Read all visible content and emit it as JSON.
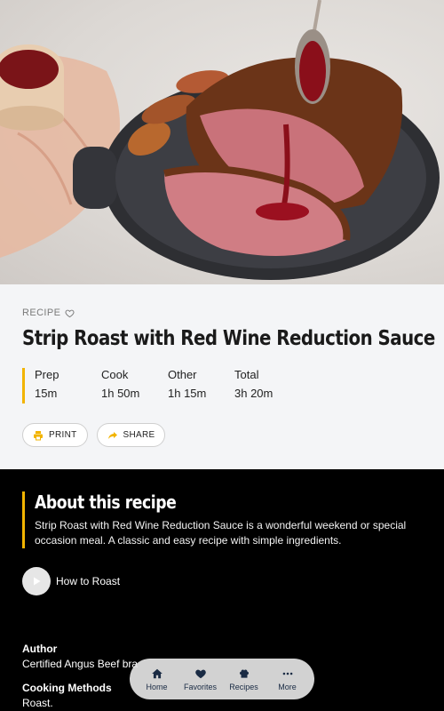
{
  "hero": {
    "alt_subject": "roast"
  },
  "recipe": {
    "eyebrow": "RECIPE",
    "title": "Strip Roast with Red Wine Reduction Sauce",
    "times": [
      {
        "label": "Prep",
        "value": "15m"
      },
      {
        "label": "Cook",
        "value": "1h 50m"
      },
      {
        "label": "Other",
        "value": "1h 15m"
      },
      {
        "label": "Total",
        "value": "3h 20m"
      }
    ],
    "print_label": "PRINT",
    "share_label": "SHARE"
  },
  "about": {
    "heading": "About this recipe",
    "body": "Strip Roast with Red Wine Reduction Sauce is a wonderful weekend or special occasion meal. A classic and easy recipe with simple ingredients.",
    "video_label": "How to Roast",
    "author_label": "Author",
    "author_value": "Certified Angus Beef bra",
    "methods_label": "Cooking Methods",
    "methods_value": "Roast."
  },
  "nav": {
    "items": [
      {
        "label": "Home",
        "icon": "home-icon"
      },
      {
        "label": "Favorites",
        "icon": "heart-icon"
      },
      {
        "label": "Recipes",
        "icon": "chef-hat-icon"
      },
      {
        "label": "More",
        "icon": "more-icon"
      }
    ]
  },
  "colors": {
    "accent": "#f2b400",
    "dark": "#000000",
    "panel": "#f4f5f7"
  }
}
